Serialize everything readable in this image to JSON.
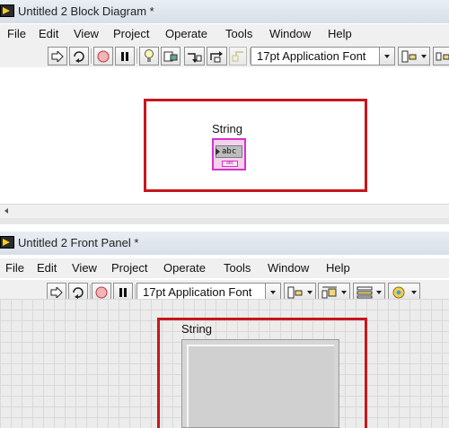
{
  "block_diagram": {
    "title": "Untitled 2 Block Diagram *",
    "menu": [
      "File",
      "Edit",
      "View",
      "Project",
      "Operate",
      "Tools",
      "Window",
      "Help"
    ],
    "font": "17pt Application Font",
    "control_label": "String",
    "terminal_text": "abc",
    "terminal_foot": "abc"
  },
  "front_panel": {
    "title": "Untitled 2 Front Panel *",
    "menu": [
      "File",
      "Edit",
      "View",
      "Project",
      "Operate",
      "Tools",
      "Window",
      "Help"
    ],
    "font": "17pt Application Font",
    "control_label": "String"
  },
  "colors": {
    "highlight": "#c8161d",
    "string_terminal": "#d633c9"
  }
}
